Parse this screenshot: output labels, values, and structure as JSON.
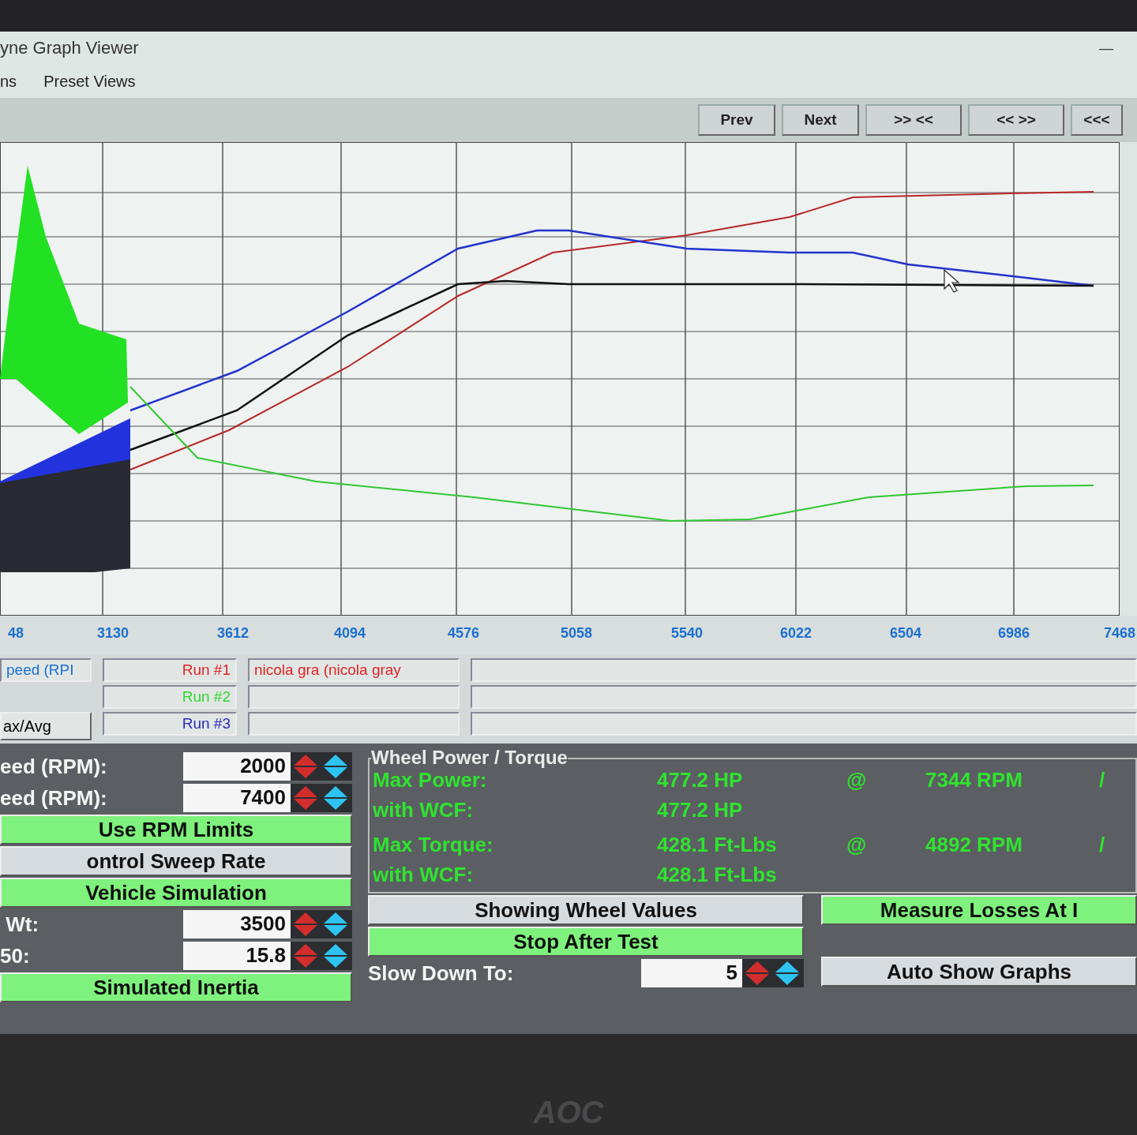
{
  "window": {
    "title": "yne Graph Viewer",
    "minimize": "—"
  },
  "menu": [
    "ns",
    "Preset Views"
  ],
  "toolbar": [
    "Prev",
    "Next",
    ">> <<",
    "<< >>",
    "<<<"
  ],
  "x_axis_labels": [
    "48",
    "3130",
    "3612",
    "4094",
    "4576",
    "5058",
    "5540",
    "6022",
    "6504",
    "6986",
    "7468"
  ],
  "legend": {
    "channel_field": "peed (RPI",
    "max_avg_button": "ax/Avg",
    "runs": [
      {
        "label": "Run #1",
        "color": "#e02424",
        "file": "nicola gra (nicola gray"
      },
      {
        "label": "Run #2",
        "color": "#2fd82f"
      },
      {
        "label": "Run #3",
        "color": "#2a2ab8"
      }
    ]
  },
  "settings": [
    {
      "kind": "number",
      "label": "eed (RPM):",
      "value": "2000"
    },
    {
      "kind": "number",
      "label": "eed (RPM):",
      "value": "7400"
    },
    {
      "kind": "toggle",
      "label": "Use RPM Limits",
      "on": true
    },
    {
      "kind": "toggle",
      "label": "ontrol Sweep Rate",
      "on": false
    },
    {
      "kind": "toggle",
      "label": "Vehicle Simulation",
      "on": true
    },
    {
      "kind": "number",
      "label": " Wt:",
      "value": "3500"
    },
    {
      "kind": "number",
      "label": "50:",
      "value": "15.8"
    },
    {
      "kind": "toggle",
      "label": "Simulated Inertia",
      "on": true
    }
  ],
  "results": {
    "title": "Wheel Power / Torque",
    "rows": [
      {
        "label": "Max Power:",
        "value": "477.2 HP",
        "at": "@",
        "rpm": "7344 RPM",
        "mark": "/"
      },
      {
        "label": "with WCF:",
        "value": "477.2 HP"
      },
      {
        "label": "Max Torque:",
        "value": "428.1 Ft-Lbs",
        "at": "@",
        "rpm": "4892 RPM",
        "mark": "/"
      },
      {
        "label": "with WCF:",
        "value": "428.1 Ft-Lbs"
      }
    ]
  },
  "middle_controls": [
    {
      "kind": "toggle",
      "label": "Showing Wheel Values",
      "on": false
    },
    {
      "kind": "toggle",
      "label": "Stop After Test",
      "on": true
    },
    {
      "kind": "number",
      "label": "Slow Down To:",
      "value": "5"
    }
  ],
  "right_controls": [
    {
      "kind": "toggle",
      "label": "Measure Losses At I",
      "on": true
    },
    {
      "kind": "toggle",
      "label": "Auto Show Graphs",
      "on": false
    }
  ],
  "bezel": {
    "logo": "AOC"
  }
}
